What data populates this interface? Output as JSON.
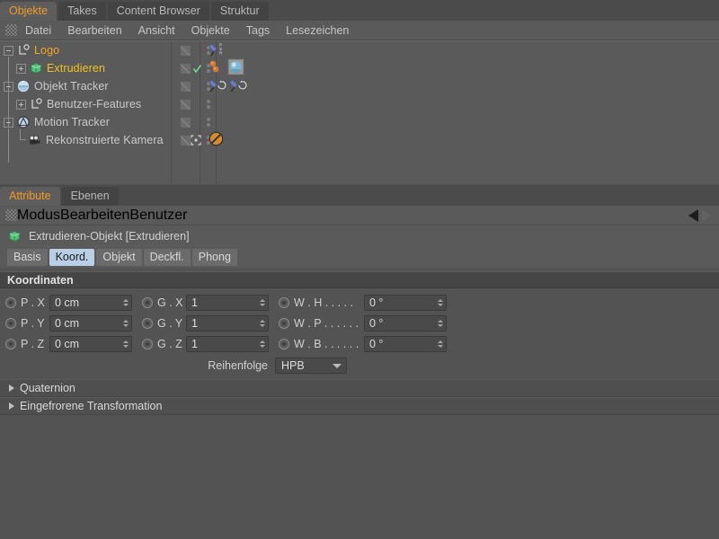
{
  "object_manager": {
    "tabs": [
      {
        "label": "Objekte",
        "active": true
      },
      {
        "label": "Takes",
        "active": false
      },
      {
        "label": "Content Browser",
        "active": false
      },
      {
        "label": "Struktur",
        "active": false
      }
    ],
    "menu": [
      "Datei",
      "Bearbeiten",
      "Ansicht",
      "Objekte",
      "Tags",
      "Lesezeichen"
    ],
    "rows": [
      {
        "name": "Logo",
        "indent": 0,
        "icon": "null-object-icon",
        "selected": true,
        "expander": "minus",
        "tags": [
          "psr-constraint-tag"
        ]
      },
      {
        "name": "Extrudieren",
        "indent": 1,
        "icon": "extrude-object-icon",
        "selected": true,
        "expander": "plus",
        "tags": [
          "material-tag",
          "material-tag",
          "texture-tag"
        ],
        "check": true
      },
      {
        "name": "Objekt Tracker",
        "indent": 0,
        "icon": "object-tracker-icon",
        "selected": false,
        "expander": "minus",
        "tags": [
          "constraint-tag",
          "constraint-tag"
        ]
      },
      {
        "name": "Benutzer-Features",
        "indent": 1,
        "icon": "null-object-icon",
        "selected": false,
        "expander": "plus",
        "tags": []
      },
      {
        "name": "Motion Tracker",
        "indent": 0,
        "icon": "motion-tracker-icon",
        "selected": false,
        "expander": "minus",
        "tags": []
      },
      {
        "name": "Rekonstruierte Kamera",
        "indent": 1,
        "icon": "camera-icon",
        "selected": false,
        "expander": "none",
        "tags": [
          "protection-tag"
        ],
        "marker": true
      }
    ]
  },
  "attribute_manager": {
    "tabs": [
      {
        "label": "Attribute",
        "active": true
      },
      {
        "label": "Ebenen",
        "active": false
      }
    ],
    "menu": [
      "Modus",
      "Bearbeiten",
      "Benutzer"
    ],
    "object_title": "Extrudieren-Objekt [Extrudieren]",
    "object_icon": "extrude-object-icon",
    "mode_tabs": [
      {
        "label": "Basis",
        "active": false
      },
      {
        "label": "Koord.",
        "active": true
      },
      {
        "label": "Objekt",
        "active": false
      },
      {
        "label": "Deckfl.",
        "active": false
      },
      {
        "label": "Phong",
        "active": false
      }
    ],
    "coordinates": {
      "section_title": "Koordinaten",
      "rows": [
        {
          "pos_label": "P . X",
          "pos_value": "0 cm",
          "scale_label": "G . X",
          "scale_value": "1",
          "rot_label": "W . H . . . . .",
          "rot_value": "0 °"
        },
        {
          "pos_label": "P . Y",
          "pos_value": "0 cm",
          "scale_label": "G . Y",
          "scale_value": "1",
          "rot_label": "W . P . . . . . .",
          "rot_value": "0 °"
        },
        {
          "pos_label": "P . Z",
          "pos_value": "0 cm",
          "scale_label": "G . Z",
          "scale_value": "1",
          "rot_label": "W . B . . . . . .",
          "rot_value": "0 °"
        }
      ],
      "order_label": "Reihenfolge",
      "order_value": "HPB"
    },
    "folds": [
      {
        "label": "Quaternion"
      },
      {
        "label": "Eingefrorene Transformation"
      }
    ]
  },
  "colors": {
    "accent_orange": "#f29a21",
    "selected_label": "#f5a623",
    "panel_bg": "#535353",
    "tree_bg": "#5a5a5a",
    "active_mode_tab": "#b9cfe6"
  }
}
